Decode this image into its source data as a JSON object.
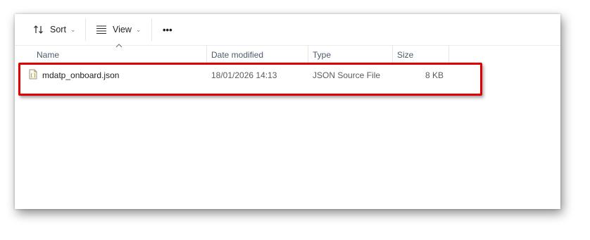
{
  "toolbar": {
    "sort_label": "Sort",
    "view_label": "View",
    "more_label": "•••"
  },
  "columns": {
    "name": "Name",
    "date_modified": "Date modified",
    "type": "Type",
    "size": "Size"
  },
  "files": [
    {
      "name": "mdatp_onboard.json",
      "date_modified": "18/01/2026 14:13",
      "type": "JSON Source File",
      "size": "8 KB",
      "icon": "json-file-icon"
    }
  ],
  "colors": {
    "highlight": "#e00000",
    "header_text": "#4c5a6e"
  }
}
